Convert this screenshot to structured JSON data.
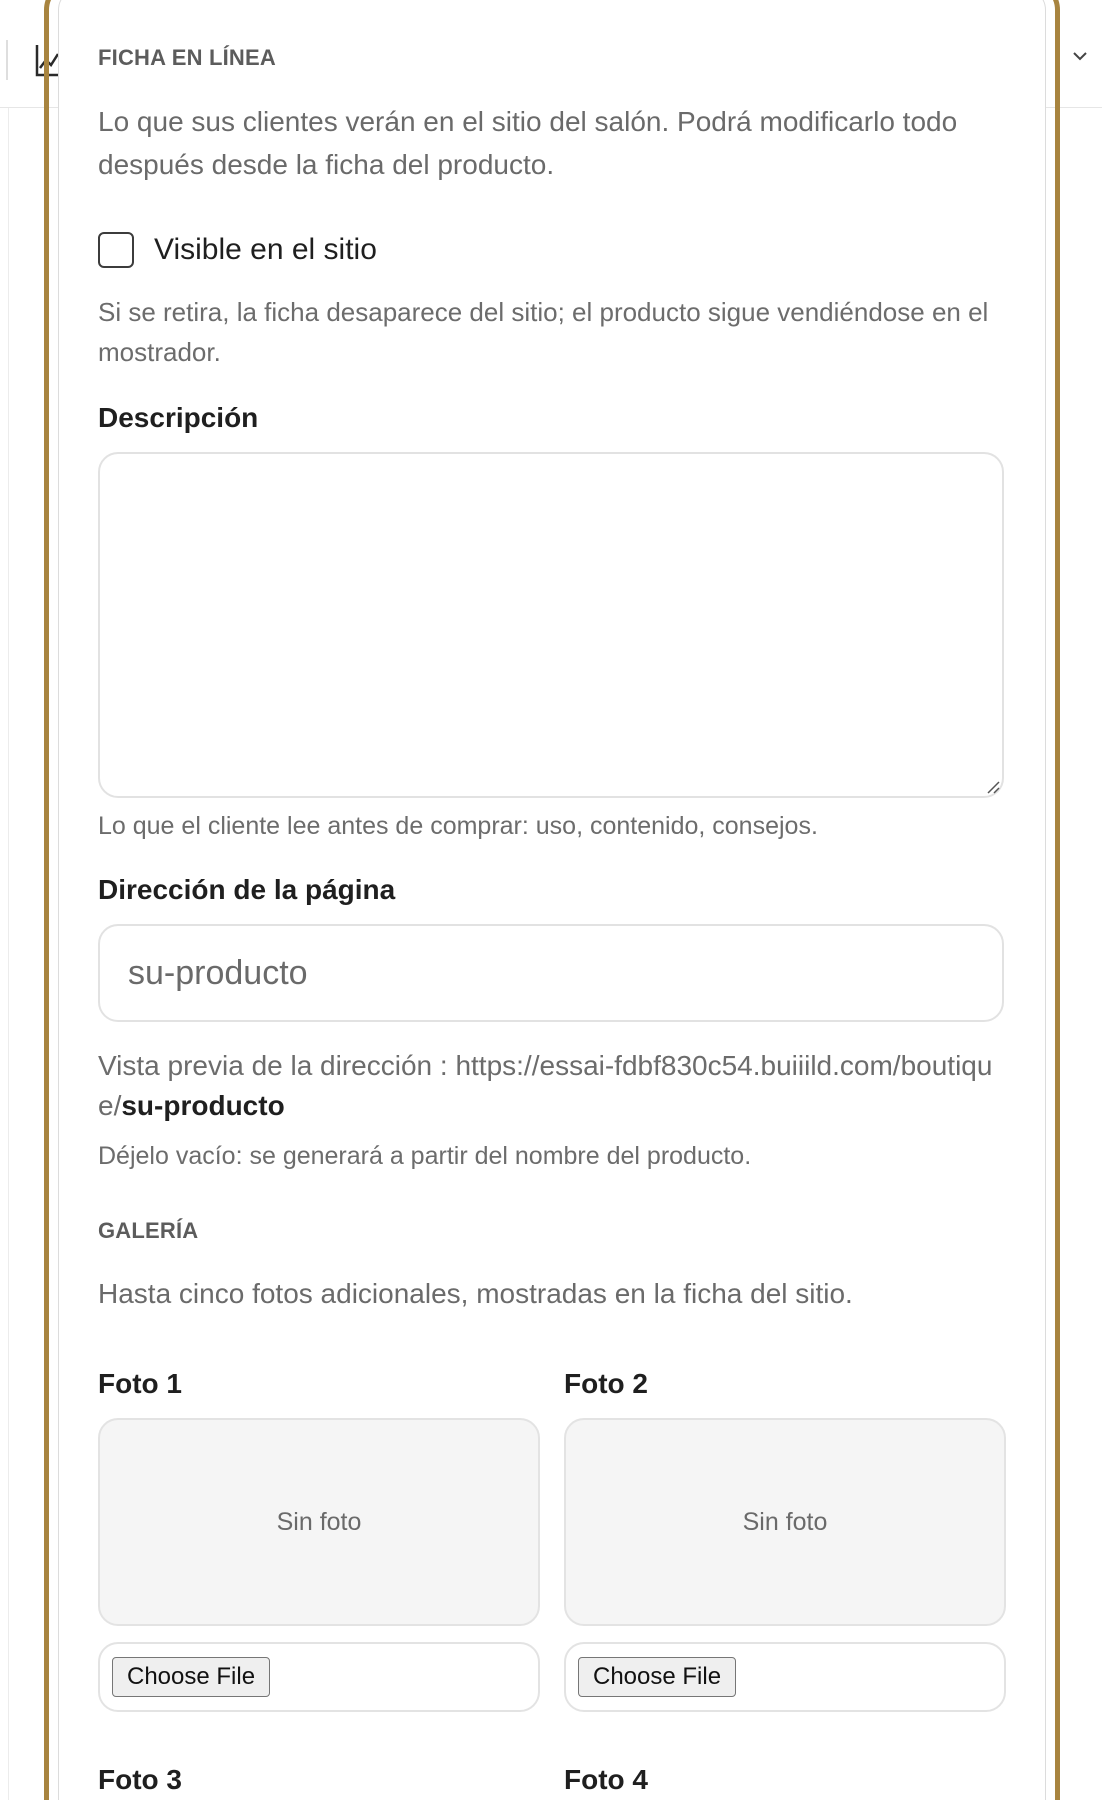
{
  "online_listing": {
    "section_title": "FICHA EN LÍNEA",
    "intro": "Lo que sus clientes verán en el sitio del salón. Podrá modificarlo todo después desde la ficha del producto.",
    "visible": {
      "label": "Visible en el sitio",
      "checked": false,
      "hint": "Si se retira, la ficha desaparece del sitio; el producto sigue vendiéndose en el mostrador."
    },
    "description": {
      "label": "Descripción",
      "value": "",
      "hint": "Lo que el cliente lee antes de comprar: uso, contenido, consejos."
    },
    "page_address": {
      "label": "Dirección de la página",
      "placeholder": "su-producto",
      "preview_prefix": "Vista previa de la dirección : https://essai-fdbf830c54.buiiild.com/boutique/",
      "preview_slug": "su-producto",
      "hint": "Déjelo vacío: se generará a partir del nombre del producto."
    }
  },
  "gallery": {
    "section_title": "GALERÍA",
    "intro": "Hasta cinco fotos adicionales, mostradas en la ficha del sitio.",
    "photos": [
      {
        "label": "Foto 1",
        "empty_text": "Sin foto",
        "button_label": "Choose File"
      },
      {
        "label": "Foto 2",
        "empty_text": "Sin foto",
        "button_label": "Choose File"
      },
      {
        "label": "Foto 3"
      },
      {
        "label": "Foto 4"
      }
    ]
  },
  "colors": {
    "highlight_ring": "#a8843f",
    "muted_text": "#6a6a6a",
    "border": "#e2e2e2"
  },
  "icons": {
    "toolbar_left": "chart-icon",
    "toolbar_right": "chevron-down-icon"
  }
}
